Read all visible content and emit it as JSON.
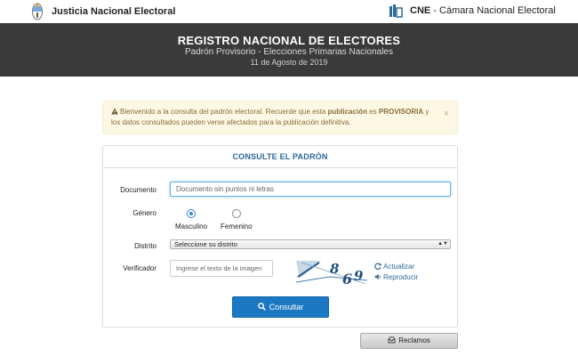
{
  "header": {
    "left_brand": "Justicia Nacional Electoral",
    "right_brand_bold": "CNE",
    "right_brand_rest": " - Cámara Nacional Electoral"
  },
  "hero": {
    "title": "REGISTRO NACIONAL DE ELECTORES",
    "subtitle": "Padrón Provisorio - Elecciones Primarias Nacionales",
    "date": "11 de Agosto de 2019"
  },
  "alert": {
    "text_1": "Bienvenido a la consulta del padrón electoral. Recuerde que esta ",
    "bold_1": "publicación",
    "text_2": " es ",
    "bold_2": "PROVISORIA",
    "text_3": " y los datos consultados pueden verse afectados para la publicación definitiva.",
    "close": "×"
  },
  "form": {
    "title": "CONSULTE EL PADRÓN",
    "documento_label": "Documento",
    "documento_placeholder": "Documento sin puntos ni letras",
    "genero_label": "Género",
    "genero_options": [
      "Masculino",
      "Femenino"
    ],
    "genero_selected": "Masculino",
    "distrito_label": "Distrito",
    "distrito_value": "Seleccione su distrito",
    "verificador_label": "Verificador",
    "verificador_placeholder": "Ingrese el texto de la imagen",
    "captcha_text": "869",
    "actualizar": "Actualizar",
    "reproducir": "Reproducir",
    "submit": "Consultar"
  },
  "footer": {
    "reclamos": "Reclamos"
  },
  "colors": {
    "hero_bg": "#3a3a3a",
    "alert_bg": "#fcf8e3",
    "alert_text": "#8a6d3b",
    "primary": "#1c78c2",
    "link": "#2a6a99"
  }
}
